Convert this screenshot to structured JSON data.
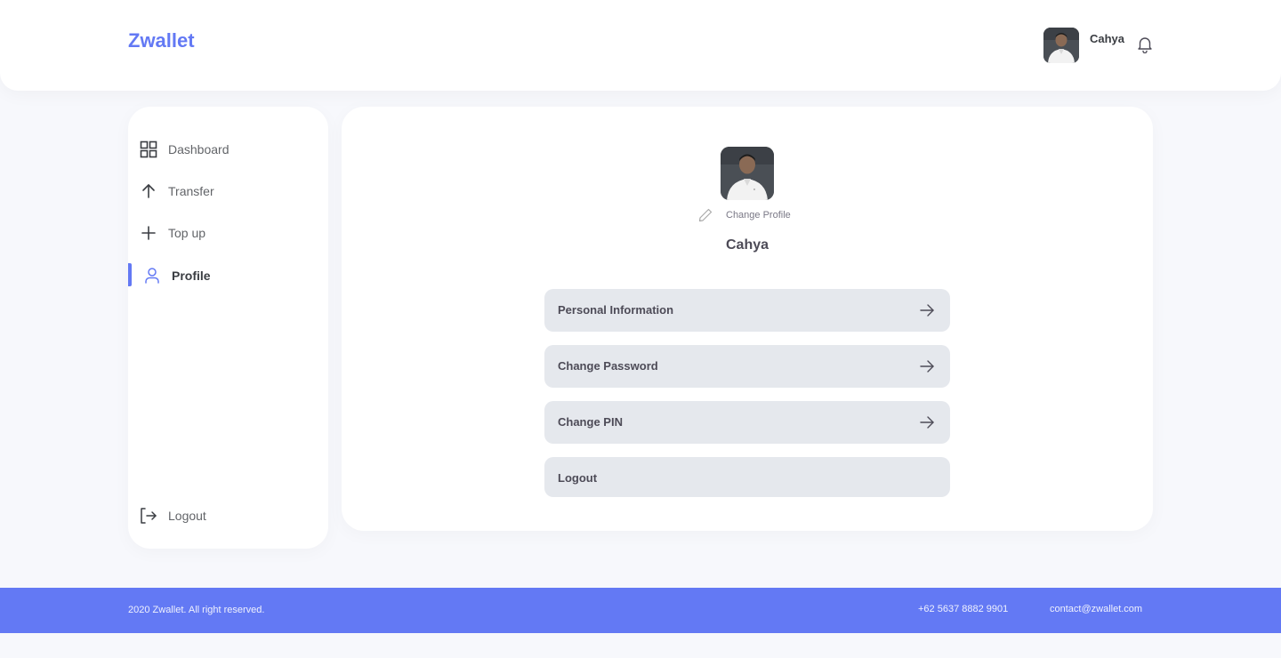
{
  "header": {
    "brand": "Zwallet",
    "user_name": "Cahya",
    "avatar_icon": "user-photo",
    "notification_icon": "bell-icon"
  },
  "sidebar": {
    "items": [
      {
        "label": "Dashboard",
        "icon": "grid-icon",
        "active": false
      },
      {
        "label": "Transfer",
        "icon": "arrow-up-icon",
        "active": false
      },
      {
        "label": "Top up",
        "icon": "plus-icon",
        "active": false
      },
      {
        "label": "Profile",
        "icon": "user-icon",
        "active": true
      }
    ],
    "logout": {
      "label": "Logout",
      "icon": "logout-icon"
    }
  },
  "profile": {
    "change_profile_label": "Change Profile",
    "name": "Cahya",
    "menu": [
      {
        "label": "Personal Information",
        "has_arrow": true
      },
      {
        "label": "Change Password",
        "has_arrow": true
      },
      {
        "label": "Change PIN",
        "has_arrow": true
      },
      {
        "label": "Logout",
        "has_arrow": false
      }
    ]
  },
  "footer": {
    "copyright": "2020 Zwallet. All right reserved.",
    "phone": "+62 5637 8882 9901",
    "email": "contact@zwallet.com"
  },
  "colors": {
    "accent": "#6379F4",
    "background": "#F7F8FC",
    "card": "#FFFFFF",
    "menu_button": "#E5E8ED"
  }
}
